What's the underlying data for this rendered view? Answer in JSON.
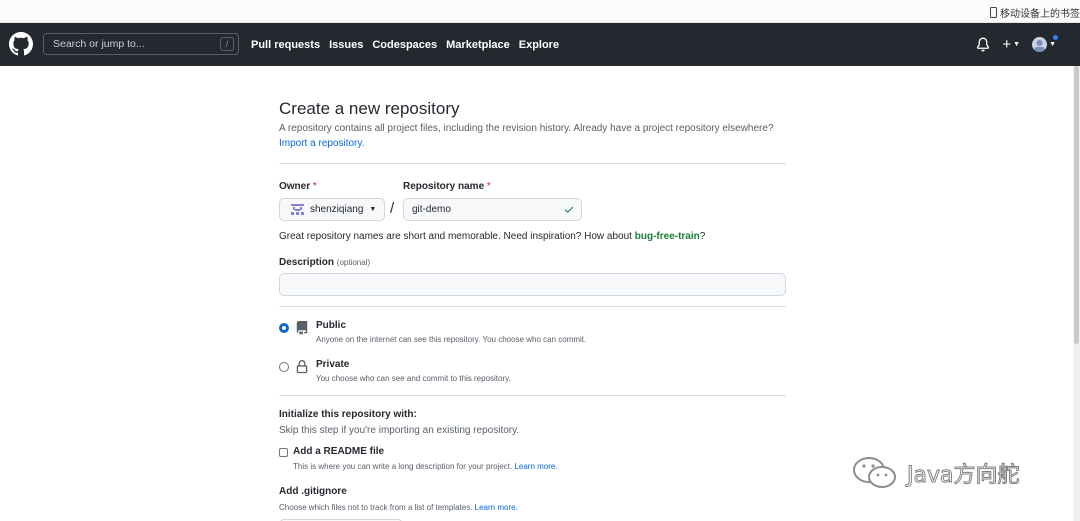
{
  "browser": {
    "bookmark_mobile": "移动设备上的书签"
  },
  "header": {
    "search_placeholder": "Search or jump to...",
    "search_shortcut": "/",
    "nav": [
      "Pull requests",
      "Issues",
      "Codespaces",
      "Marketplace",
      "Explore"
    ],
    "plus_label": "+"
  },
  "page": {
    "title": "Create a new repository",
    "subtitle": "A repository contains all project files, including the revision history. Already have a project repository elsewhere?",
    "import_link": "Import a repository."
  },
  "form": {
    "owner_label": "Owner",
    "owner_required": "*",
    "owner_value": "shenziqiang",
    "separator": "/",
    "repo_label": "Repository name",
    "repo_required": "*",
    "repo_value": "git-demo",
    "hint_prefix": "Great repository names are short and memorable. Need inspiration? How about ",
    "hint_suggestion": "bug-free-train",
    "hint_suffix": "?",
    "description_label": "Description",
    "description_optional": "(optional)",
    "description_value": ""
  },
  "visibility": {
    "options": [
      {
        "title": "Public",
        "desc": "Anyone on the internet can see this repository. You choose who can commit.",
        "checked": true
      },
      {
        "title": "Private",
        "desc": "You choose who can see and commit to this repository.",
        "checked": false
      }
    ]
  },
  "initialize": {
    "title": "Initialize this repository with:",
    "subtitle": "Skip this step if you're importing an existing repository.",
    "readme_title": "Add a README file",
    "readme_desc": "This is where you can write a long description for your project.",
    "readme_link": "Learn more.",
    "readme_checked": false,
    "gitignore_title": "Add .gitignore",
    "gitignore_desc": "Choose which files not to track from a list of templates.",
    "gitignore_link": "Learn more."
  },
  "watermark": {
    "text": "Java方向舵"
  },
  "colors": {
    "header_bg": "#24292f",
    "link": "#0969da",
    "success": "#1a7f37",
    "required": "#cf222e"
  }
}
